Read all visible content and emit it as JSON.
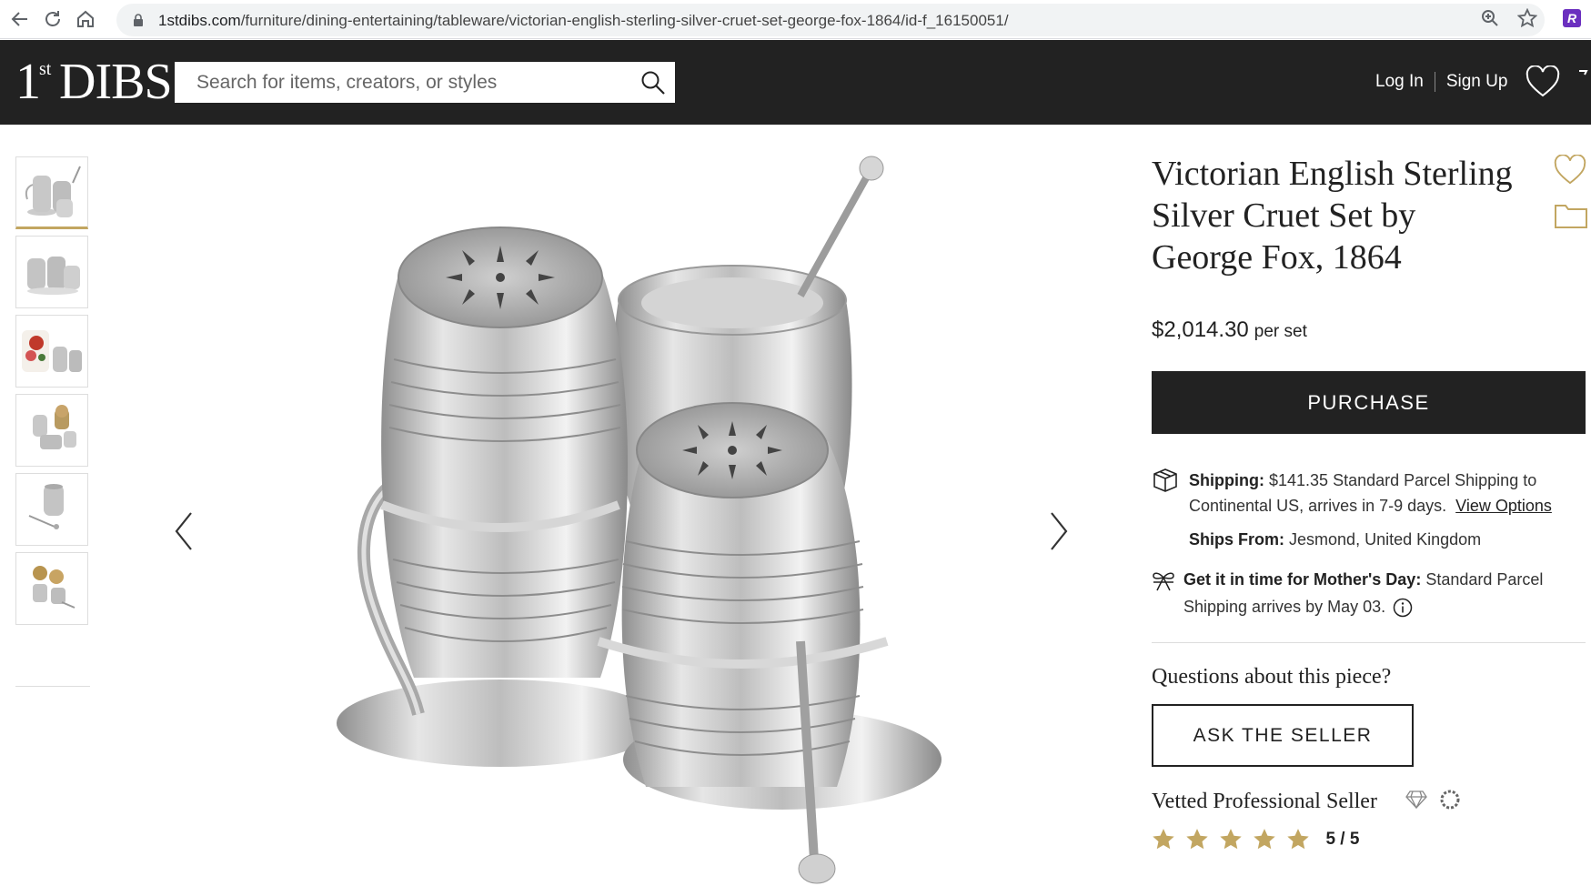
{
  "browser": {
    "url_domain": "1stdibs.com",
    "url_path": "/furniture/dining-entertaining/tableware/victorian-english-sterling-silver-cruet-set-george-fox-1864/id-f_16150051/",
    "extension_label": "R"
  },
  "header": {
    "logo_one": "1",
    "logo_st": "st",
    "logo_dibs": "DIBS",
    "search_placeholder": "Search for items, creators, or styles",
    "login": "Log In",
    "signup": "Sign Up"
  },
  "gallery": {
    "thumbnails": [
      {
        "name": "thumb-1-cruet-front",
        "active": true
      },
      {
        "name": "thumb-2-cruet-side",
        "active": false
      },
      {
        "name": "thumb-3-cruet-with-flowers",
        "active": false
      },
      {
        "name": "thumb-4-cruet-pieces",
        "active": false
      },
      {
        "name": "thumb-5-single-pot",
        "active": false
      },
      {
        "name": "thumb-6-open-pots",
        "active": false
      }
    ]
  },
  "product": {
    "title": "Victorian English Sterling Silver Cruet Set by George Fox, 1864",
    "price": "$2,014.30",
    "price_unit": "per set",
    "purchase_label": "PURCHASE",
    "shipping_label": "Shipping:",
    "shipping_text": "$141.35 Standard Parcel Shipping to Continental US, arrives in 7-9 days.",
    "shipping_link": "View Options",
    "ships_from_label": "Ships From:",
    "ships_from_value": "Jesmond, United Kingdom",
    "gift_label": "Get it in time for Mother's Day:",
    "gift_text": "Standard Parcel Shipping arrives by May 03.",
    "questions_heading": "Questions about this piece?",
    "ask_label": "ASK THE SELLER",
    "seller_label": "Vetted Professional Seller",
    "rating_text": "5 / 5",
    "rating_value": 5,
    "star_color": "#c2a661"
  },
  "colors": {
    "header_bg": "#222222",
    "accent_gold": "#c2a661"
  }
}
